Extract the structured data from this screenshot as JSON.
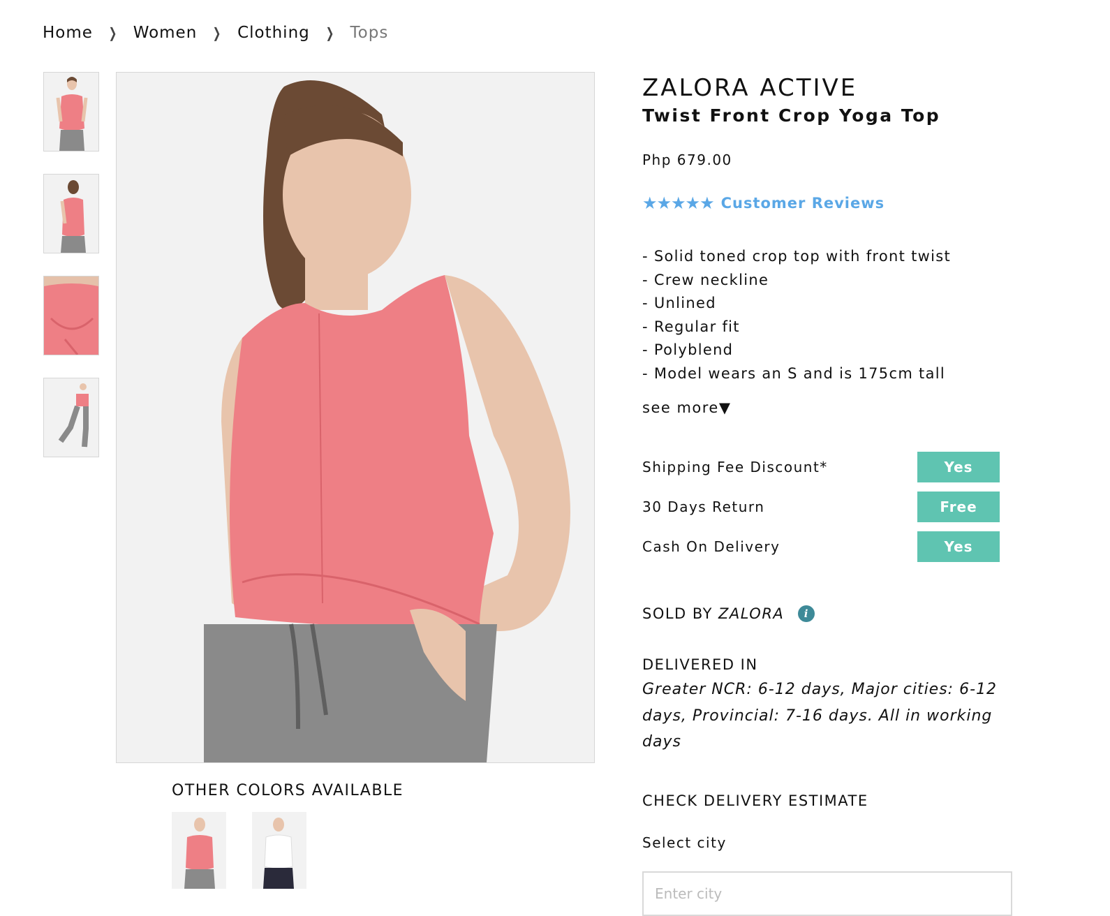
{
  "breadcrumb": {
    "items": [
      "Home",
      "Women",
      "Clothing",
      "Tops"
    ]
  },
  "product": {
    "brand": "ZALORA ACTIVE",
    "name": "Twist Front Crop Yoga Top",
    "price": "Php 679.00",
    "stars": "★★★★★",
    "reviews_label": "Customer Reviews",
    "description": [
      "- Solid toned crop top with front twist",
      "- Crew neckline",
      "- Unlined",
      "- Regular fit",
      "- Polyblend",
      "- Model wears an S and is 175cm tall"
    ],
    "see_more": "see more▼"
  },
  "features": [
    {
      "label": "Shipping Fee Discount*",
      "value": "Yes"
    },
    {
      "label": "30 Days Return",
      "value": "Free"
    },
    {
      "label": "Cash On Delivery",
      "value": "Yes"
    }
  ],
  "seller": {
    "label": "SOLD BY",
    "name": "ZALORA",
    "info_icon": "i"
  },
  "delivery": {
    "title": "DELIVERED IN",
    "text": "Greater NCR: 6-12 days, Major cities: 6-12 days, Provincial: 7-16 days. All in working days"
  },
  "estimate": {
    "title": "CHECK DELIVERY ESTIMATE",
    "select_label": "Select city",
    "placeholder": "Enter city"
  },
  "other_colors": {
    "title": "OTHER COLORS AVAILABLE"
  },
  "colors": {
    "accent_blue": "#5aa7e6",
    "badge_teal": "#5fc4b1",
    "info_teal": "#3e8a98",
    "top_pink": "#ee7f85",
    "pants_gray": "#8a8a8a"
  }
}
